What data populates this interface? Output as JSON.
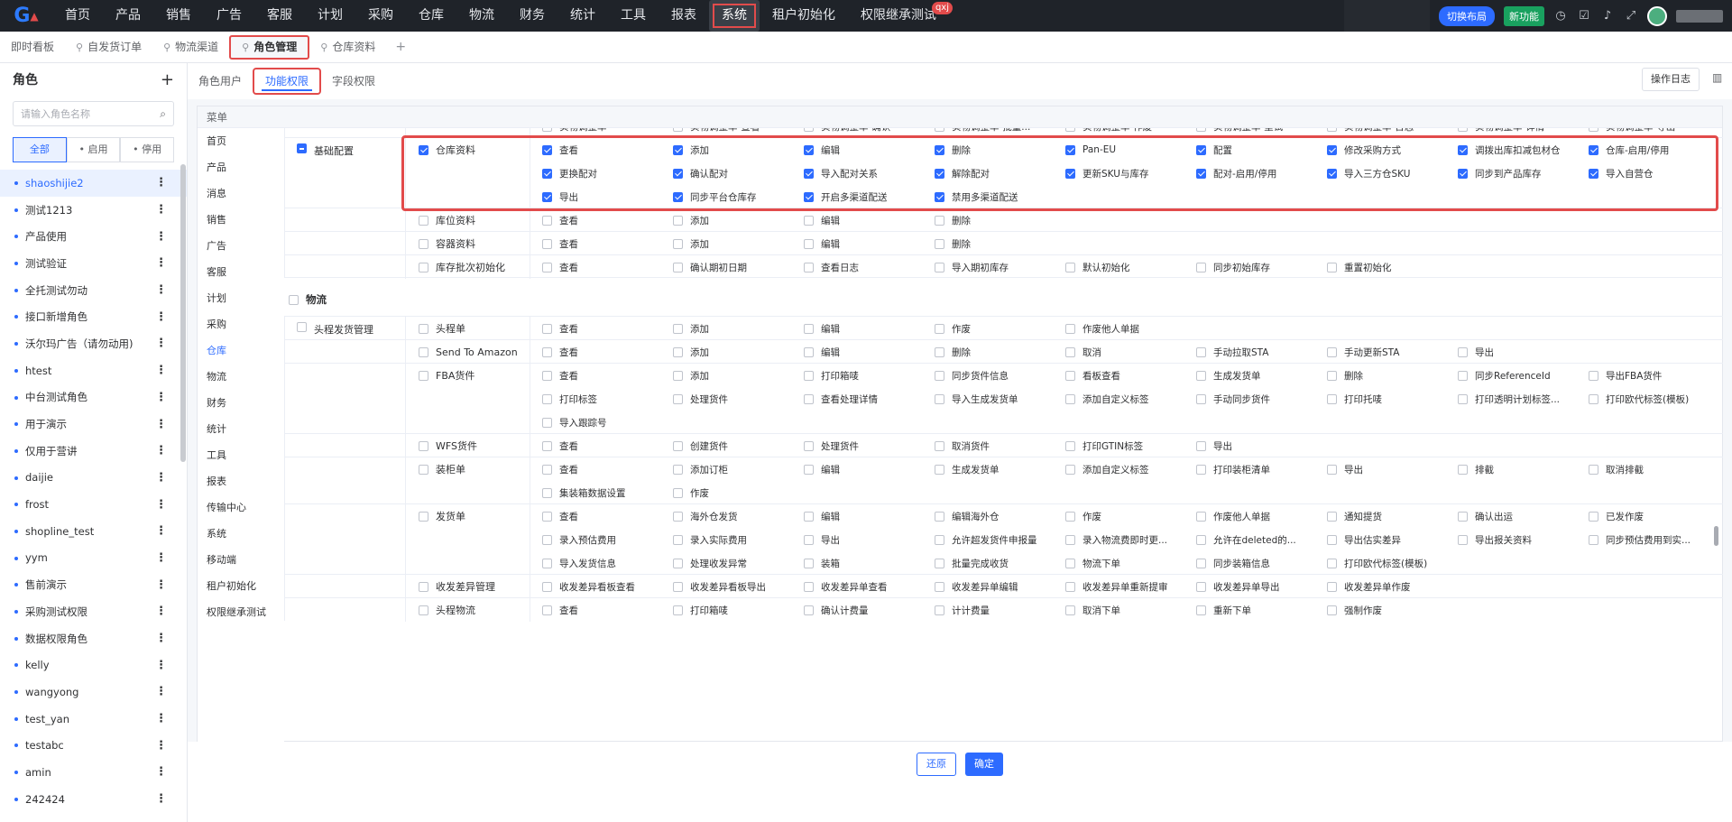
{
  "nav": {
    "items": [
      "首页",
      "产品",
      "销售",
      "广告",
      "客服",
      "计划",
      "采购",
      "仓库",
      "物流",
      "财务",
      "统计",
      "工具",
      "报表",
      "系统",
      "租户初始化",
      "权限继承测试"
    ],
    "active_index": 13,
    "badge": "qxj",
    "switch_layout": "切换布局",
    "new_feature": "新功能"
  },
  "tabs": [
    {
      "label": "即时看板",
      "active": false,
      "pin": false
    },
    {
      "label": "自发货订单",
      "active": false,
      "pin": true
    },
    {
      "label": "物流渠道",
      "active": false,
      "pin": true
    },
    {
      "label": "角色管理",
      "active": true,
      "pin": true
    },
    {
      "label": "仓库资料",
      "active": false,
      "pin": true
    }
  ],
  "roles_panel": {
    "title": "角色",
    "search_placeholder": "请输入角色名称",
    "filters": [
      "全部",
      "启用",
      "停用"
    ],
    "roles": [
      "shaoshijie2",
      "测试1213",
      "产品使用",
      "测试验证",
      "全托测试勿动",
      "接口新增角色",
      "沃尔玛广告（请勿动用)",
      "htest",
      "中台测试角色",
      "用于演示",
      "仅用于营讲",
      "daijie",
      "frost",
      "shopline_test",
      "yym",
      "售前演示",
      "采购测试权限",
      "数据权限角色",
      "kelly",
      "wangyong",
      "test_yan",
      "testabc",
      "amin",
      "242424"
    ],
    "selected_index": 0
  },
  "sub_tabs": [
    "角色用户",
    "功能权限",
    "字段权限"
  ],
  "sub_tab_active": 1,
  "operation_log": "操作日志",
  "menu_header": "菜单",
  "side_menu": [
    "首页",
    "产品",
    "消息",
    "销售",
    "广告",
    "客服",
    "计划",
    "采购",
    "仓库",
    "物流",
    "财务",
    "统计",
    "工具",
    "报表",
    "传输中心",
    "系统",
    "移动端",
    "租户初始化",
    "权限继承测试"
  ],
  "side_menu_active": 8,
  "perm_rows": [
    {
      "group": "",
      "group_state": "",
      "module": "",
      "module_state": "",
      "perms": [
        [
          "实物调整单",
          ""
        ],
        [
          "实物调整单-查看",
          ""
        ],
        [
          "实物调整单-确认",
          ""
        ],
        [
          "实物调整单-批量...",
          ""
        ],
        [
          "实物调整单-作废",
          ""
        ],
        [
          "实物调整单-重试",
          ""
        ],
        [
          "实物调整单-日志",
          ""
        ],
        [
          "实物调整单-详情",
          ""
        ],
        [
          "实物调整单-导出",
          ""
        ]
      ]
    },
    {
      "group": "基础配置",
      "group_state": "ind",
      "module": "仓库资料",
      "module_state": "on",
      "perms": [
        [
          "查看",
          "on"
        ],
        [
          "添加",
          "on"
        ],
        [
          "编辑",
          "on"
        ],
        [
          "删除",
          "on"
        ],
        [
          "Pan-EU",
          "on"
        ],
        [
          "配置",
          "on"
        ],
        [
          "修改采购方式",
          "on"
        ],
        [
          "调拨出库扣减包材仓",
          "on"
        ],
        [
          "仓库-启用/停用",
          "on"
        ],
        [
          "更换配对",
          "on"
        ],
        [
          "确认配对",
          "on"
        ],
        [
          "导入配对关系",
          "on"
        ],
        [
          "解除配对",
          "on"
        ],
        [
          "更新SKU与库存",
          "on"
        ],
        [
          "配对-启用/停用",
          "on"
        ],
        [
          "导入三方仓SKU",
          "on"
        ],
        [
          "同步到产品库存",
          "on"
        ],
        [
          "导入自营仓",
          "on"
        ],
        [
          "导出",
          "on"
        ],
        [
          "同步平台仓库存",
          "on"
        ],
        [
          "开启多渠道配送",
          "on"
        ],
        [
          "禁用多渠道配送",
          "on"
        ]
      ]
    },
    {
      "group": "",
      "group_state": "",
      "module": "库位资料",
      "module_state": "",
      "perms": [
        [
          "查看",
          ""
        ],
        [
          "添加",
          ""
        ],
        [
          "编辑",
          ""
        ],
        [
          "删除",
          ""
        ]
      ]
    },
    {
      "group": "",
      "group_state": "",
      "module": "容器资料",
      "module_state": "",
      "perms": [
        [
          "查看",
          ""
        ],
        [
          "添加",
          ""
        ],
        [
          "编辑",
          ""
        ],
        [
          "删除",
          ""
        ]
      ]
    },
    {
      "group": "",
      "group_state": "",
      "module": "库存批次初始化",
      "module_state": "",
      "perms": [
        [
          "查看",
          ""
        ],
        [
          "确认期初日期",
          ""
        ],
        [
          "查看日志",
          ""
        ],
        [
          "导入期初库存",
          ""
        ],
        [
          "默认初始化",
          ""
        ],
        [
          "同步初始库存",
          ""
        ],
        [
          "重置初始化",
          ""
        ]
      ]
    }
  ],
  "section2_title": "物流",
  "perm_rows2": [
    {
      "group": "头程发货管理",
      "group_state": "",
      "module": "头程单",
      "module_state": "",
      "perms": [
        [
          "查看",
          ""
        ],
        [
          "添加",
          ""
        ],
        [
          "编辑",
          ""
        ],
        [
          "作废",
          ""
        ],
        [
          "作废他人单据",
          ""
        ]
      ]
    },
    {
      "group": "",
      "group_state": "",
      "module": "Send To Amazon",
      "module_state": "",
      "perms": [
        [
          "查看",
          ""
        ],
        [
          "添加",
          ""
        ],
        [
          "编辑",
          ""
        ],
        [
          "删除",
          ""
        ],
        [
          "取消",
          ""
        ],
        [
          "手动拉取STA",
          ""
        ],
        [
          "手动更新STA",
          ""
        ],
        [
          "导出",
          ""
        ]
      ]
    },
    {
      "group": "",
      "group_state": "",
      "module": "FBA货件",
      "module_state": "",
      "perms": [
        [
          "查看",
          ""
        ],
        [
          "添加",
          ""
        ],
        [
          "打印箱唛",
          ""
        ],
        [
          "同步货件信息",
          ""
        ],
        [
          "看板查看",
          ""
        ],
        [
          "生成发货单",
          ""
        ],
        [
          "删除",
          ""
        ],
        [
          "同步ReferenceId",
          ""
        ],
        [
          "导出FBA货件",
          ""
        ],
        [
          "打印标签",
          ""
        ],
        [
          "处理货件",
          ""
        ],
        [
          "查看处理详情",
          ""
        ],
        [
          "导入生成发货单",
          ""
        ],
        [
          "添加自定义标签",
          ""
        ],
        [
          "手动同步货件",
          ""
        ],
        [
          "打印托唛",
          ""
        ],
        [
          "打印透明计划标签...",
          ""
        ],
        [
          "打印欧代标签(模板)",
          ""
        ],
        [
          "导入跟踪号",
          ""
        ]
      ]
    },
    {
      "group": "",
      "group_state": "",
      "module": "WFS货件",
      "module_state": "",
      "perms": [
        [
          "查看",
          ""
        ],
        [
          "创建货件",
          ""
        ],
        [
          "处理货件",
          ""
        ],
        [
          "取消货件",
          ""
        ],
        [
          "打印GTIN标签",
          ""
        ],
        [
          "导出",
          ""
        ]
      ]
    },
    {
      "group": "",
      "group_state": "",
      "module": "装柜单",
      "module_state": "",
      "perms": [
        [
          "查看",
          ""
        ],
        [
          "添加订柜",
          ""
        ],
        [
          "编辑",
          ""
        ],
        [
          "生成发货单",
          ""
        ],
        [
          "添加自定义标签",
          ""
        ],
        [
          "打印装柜清单",
          ""
        ],
        [
          "导出",
          ""
        ],
        [
          "排截",
          ""
        ],
        [
          "取消排截",
          ""
        ],
        [
          "集装箱数据设置",
          ""
        ],
        [
          "作废",
          ""
        ]
      ]
    },
    {
      "group": "",
      "group_state": "",
      "module": "发货单",
      "module_state": "",
      "perms": [
        [
          "查看",
          ""
        ],
        [
          "海外仓发货",
          ""
        ],
        [
          "编辑",
          ""
        ],
        [
          "编辑海外仓",
          ""
        ],
        [
          "作废",
          ""
        ],
        [
          "作废他人单据",
          ""
        ],
        [
          "通知提货",
          ""
        ],
        [
          "确认出运",
          ""
        ],
        [
          "已发作废",
          ""
        ],
        [
          "录入预估费用",
          ""
        ],
        [
          "录入实际费用",
          ""
        ],
        [
          "导出",
          ""
        ],
        [
          "允许超发货件申报量",
          ""
        ],
        [
          "录入物流费即时更...",
          ""
        ],
        [
          "允许在deleted的...",
          ""
        ],
        [
          "导出估实差异",
          ""
        ],
        [
          "导出报关资料",
          ""
        ],
        [
          "同步预估费用到实...",
          ""
        ],
        [
          "导入发货信息",
          ""
        ],
        [
          "处理收发异常",
          ""
        ],
        [
          "装箱",
          ""
        ],
        [
          "批量完成收货",
          ""
        ],
        [
          "物流下单",
          ""
        ],
        [
          "同步装箱信息",
          ""
        ],
        [
          "打印欧代标签(模板)",
          ""
        ]
      ]
    },
    {
      "group": "",
      "group_state": "",
      "module": "收发差异管理",
      "module_state": "",
      "perms": [
        [
          "收发差异看板查看",
          ""
        ],
        [
          "收发差异看板导出",
          ""
        ],
        [
          "收发差异单查看",
          ""
        ],
        [
          "收发差异单编辑",
          ""
        ],
        [
          "收发差异单重新提审",
          ""
        ],
        [
          "收发差异单导出",
          ""
        ],
        [
          "收发差异单作废",
          ""
        ]
      ]
    },
    {
      "group": "",
      "group_state": "",
      "module": "头程物流",
      "module_state": "",
      "perms": [
        [
          "查看",
          ""
        ],
        [
          "打印箱唛",
          ""
        ],
        [
          "确认计费量",
          ""
        ],
        [
          "计计费量",
          ""
        ],
        [
          "取消下单",
          ""
        ],
        [
          "重新下单",
          ""
        ],
        [
          "强制作废",
          ""
        ]
      ]
    }
  ],
  "footer": {
    "reset": "还原",
    "confirm": "确定"
  }
}
